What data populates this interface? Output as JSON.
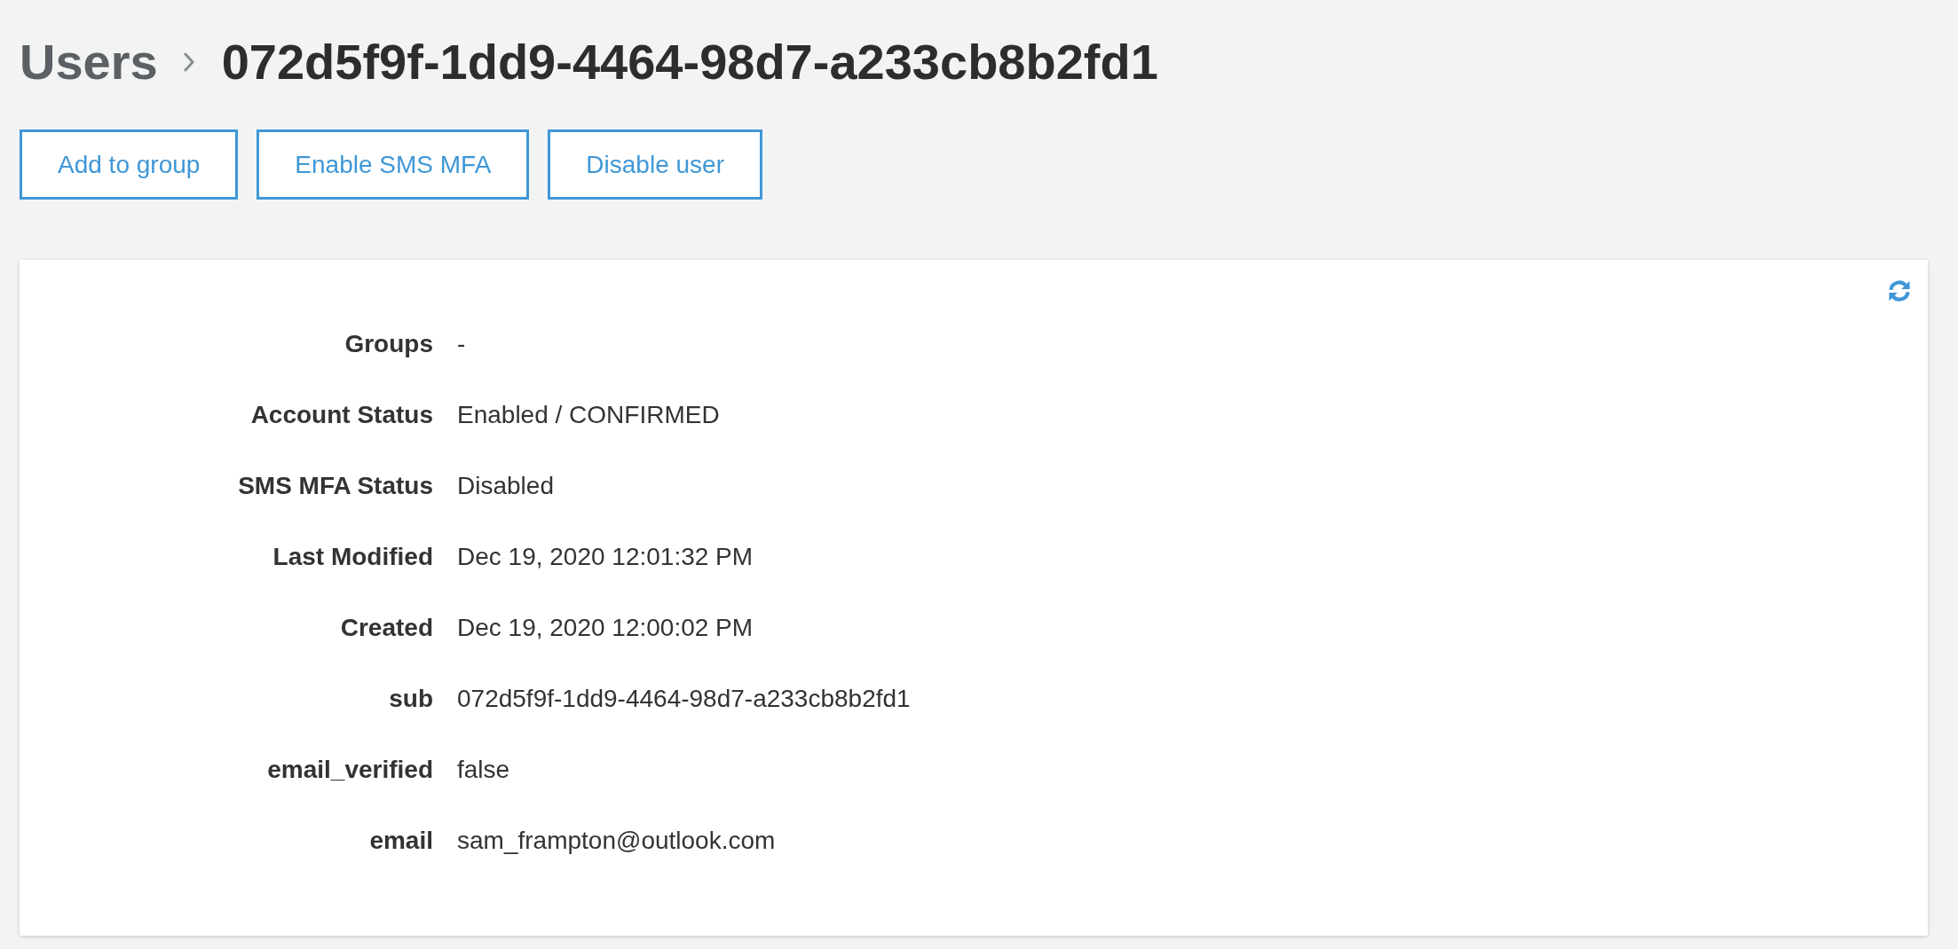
{
  "breadcrumb": {
    "parent": "Users",
    "current": "072d5f9f-1dd9-4464-98d7-a233cb8b2fd1"
  },
  "actions": [
    {
      "label": "Add to group"
    },
    {
      "label": "Enable SMS MFA"
    },
    {
      "label": "Disable user"
    }
  ],
  "details": {
    "fields": [
      {
        "label": "Groups",
        "value": "-"
      },
      {
        "label": "Account Status",
        "value": "Enabled / CONFIRMED"
      },
      {
        "label": "SMS MFA Status",
        "value": "Disabled"
      },
      {
        "label": "Last Modified",
        "value": "Dec 19, 2020 12:01:32 PM"
      },
      {
        "label": "Created",
        "value": "Dec 19, 2020 12:00:02 PM"
      },
      {
        "label": "sub",
        "value": "072d5f9f-1dd9-4464-98d7-a233cb8b2fd1"
      },
      {
        "label": "email_verified",
        "value": "false"
      },
      {
        "label": "email",
        "value": "sam_frampton@outlook.com"
      }
    ]
  }
}
